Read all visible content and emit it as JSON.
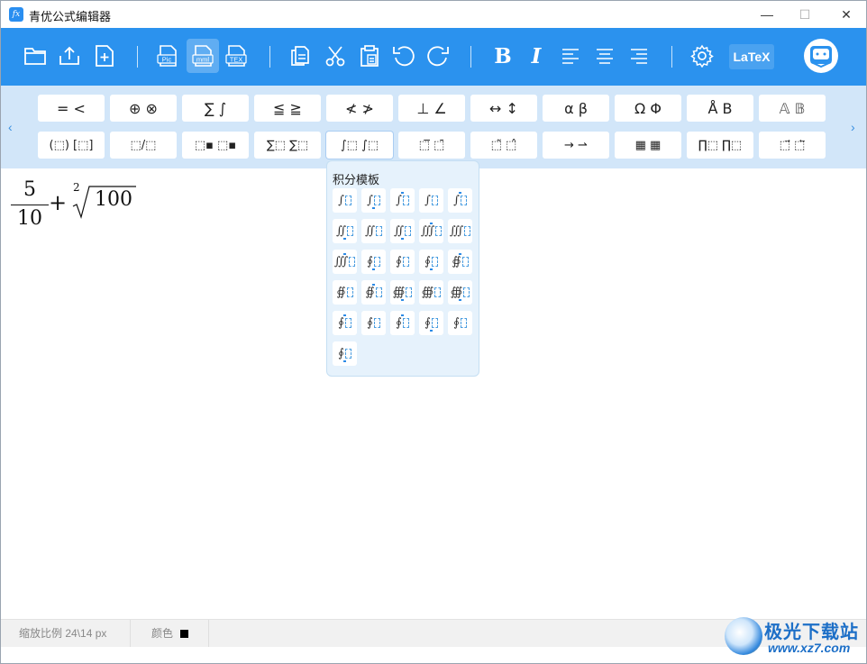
{
  "window": {
    "title": "青优公式编辑器",
    "app_icon_text": "fx",
    "controls": {
      "minimize": "—",
      "maximize": "☐",
      "close": "✕"
    }
  },
  "toolbar": {
    "buttons": [
      {
        "name": "open-folder-icon"
      },
      {
        "name": "upload-icon"
      },
      {
        "name": "new-file-icon"
      },
      {
        "name": "export-pic-icon",
        "label": "Pic"
      },
      {
        "name": "export-mml-icon",
        "label": "mml",
        "active": true
      },
      {
        "name": "export-tex-icon",
        "label": "TEX"
      },
      {
        "name": "copy-icon"
      },
      {
        "name": "cut-icon"
      },
      {
        "name": "paste-icon"
      },
      {
        "name": "undo-icon"
      },
      {
        "name": "redo-icon"
      },
      {
        "name": "bold-icon",
        "label": "B"
      },
      {
        "name": "italic-icon",
        "label": "I"
      },
      {
        "name": "align-left-icon"
      },
      {
        "name": "align-center-icon"
      },
      {
        "name": "align-right-icon"
      },
      {
        "name": "settings-icon"
      }
    ],
    "latex_label": "LaTeX",
    "accent": "#2b92ee"
  },
  "palette": {
    "row1": [
      "= <",
      "⊕ ⊗",
      "∑ ∫",
      "≦ ≧",
      "≮ ≯",
      "⊥ ∠",
      "↔ ↕",
      "α β",
      "Ω Φ",
      "Å B",
      "𝔸 𝔹"
    ],
    "row2": [
      "(⬚) [⬚]",
      "⬚/⬚",
      "⬚▪ ⬚▪",
      "∑⬚ ∑⬚",
      "∫⬚ ∫⬚",
      "⬚̅ ⬚̄",
      "⬚̃ ⬚̂",
      "→ ⇀",
      "▦ ▦",
      "∏⬚ ∏⬚",
      "⬚⃗ ⬚⃖"
    ],
    "prev_arrow": "‹",
    "next_arrow": "›"
  },
  "editor": {
    "numerator": "5",
    "denominator": "10",
    "plus": "+",
    "root_index": "2",
    "radicand": "100"
  },
  "integral_popup": {
    "title": "积分模板",
    "items": [
      "∫",
      "∫",
      "∫",
      "∫",
      "∫",
      "∬",
      "∬",
      "∬",
      "∭",
      "∭",
      "∭",
      "∮",
      "∮",
      "∮",
      "∯",
      "∯",
      "∯",
      "∰",
      "∰",
      "∰",
      "∮",
      "∮",
      "∮",
      "∮",
      "∮",
      "∮"
    ]
  },
  "status": {
    "zoom": "缩放比例 24\\14 px",
    "color_label": "颜色",
    "color_value": "#000000"
  },
  "watermark": {
    "title": "极光下载站",
    "url": "www.xz7.com"
  }
}
